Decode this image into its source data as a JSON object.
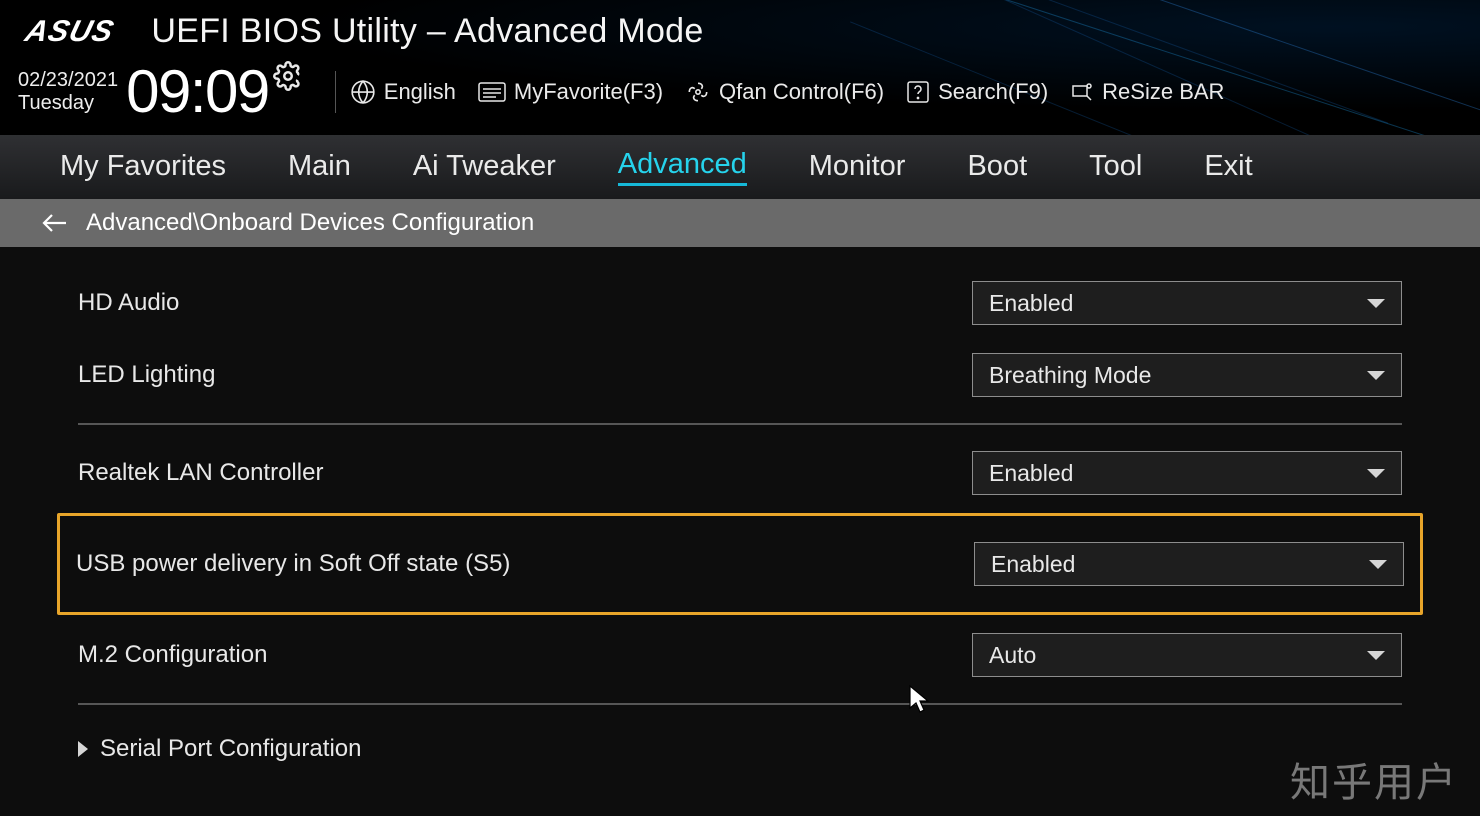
{
  "header": {
    "brand": "ASUS",
    "title": "UEFI BIOS Utility – Advanced Mode",
    "date": "02/23/2021",
    "day": "Tuesday",
    "time": "09:09",
    "utils": {
      "language": "English",
      "myfav": "MyFavorite(F3)",
      "qfan": "Qfan Control(F6)",
      "search": "Search(F9)",
      "resize": "ReSize BAR"
    }
  },
  "tabs": [
    "My Favorites",
    "Main",
    "Ai Tweaker",
    "Advanced",
    "Monitor",
    "Boot",
    "Tool",
    "Exit"
  ],
  "activeTab": "Advanced",
  "breadcrumb": "Advanced\\Onboard Devices Configuration",
  "settings": [
    {
      "label": "HD Audio",
      "value": "Enabled"
    },
    {
      "label": "LED Lighting",
      "value": "Breathing Mode"
    }
  ],
  "settings2": [
    {
      "label": "Realtek LAN Controller",
      "value": "Enabled"
    }
  ],
  "highlightSetting": {
    "label": "USB power delivery in Soft Off state (S5)",
    "value": "Enabled"
  },
  "settings3": [
    {
      "label": "M.2 Configuration",
      "value": "Auto"
    }
  ],
  "subItem": "Serial Port Configuration",
  "watermark": "知乎用户"
}
